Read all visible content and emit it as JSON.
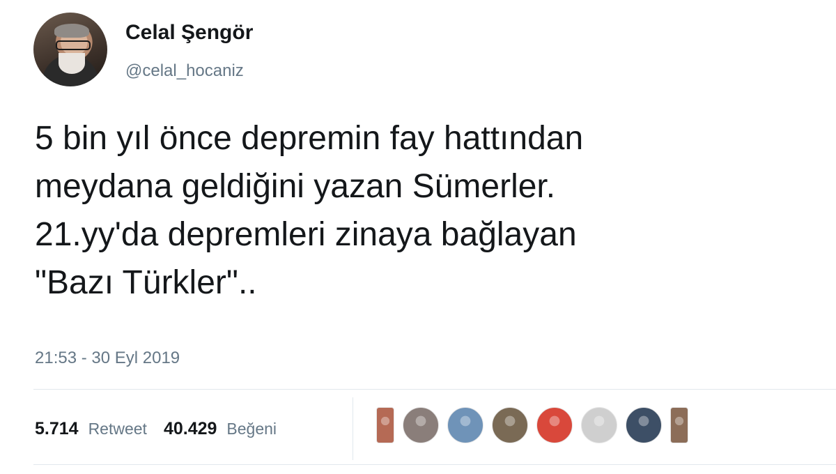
{
  "user": {
    "display_name": "Celal Şengör",
    "handle": "@celal_hocaniz"
  },
  "tweet": {
    "lines": [
      "5 bin yıl önce depremin fay hattından",
      "meydana geldiğini yazan Sümerler.",
      "21.yy'da depremleri zinaya bağlayan",
      "\"Bazı Türkler\".."
    ],
    "timestamp": "21:53 - 30 Eyl 2019"
  },
  "stats": {
    "retweet_count": "5.714",
    "retweet_label": "Retweet",
    "like_count": "40.429",
    "like_label": "Beğeni"
  },
  "likers": [
    {
      "name": "liker-avatar-1",
      "color": "#b56a55"
    },
    {
      "name": "liker-avatar-2",
      "color": "#8a7e7a"
    },
    {
      "name": "liker-avatar-3",
      "color": "#6f93b8"
    },
    {
      "name": "liker-avatar-4",
      "color": "#7a6a55"
    },
    {
      "name": "liker-avatar-5",
      "color": "#d9483b"
    },
    {
      "name": "liker-avatar-6",
      "color": "#cfcfcf"
    },
    {
      "name": "liker-avatar-7",
      "color": "#3d4f66"
    },
    {
      "name": "liker-avatar-8",
      "color": "#8c6d58"
    }
  ]
}
